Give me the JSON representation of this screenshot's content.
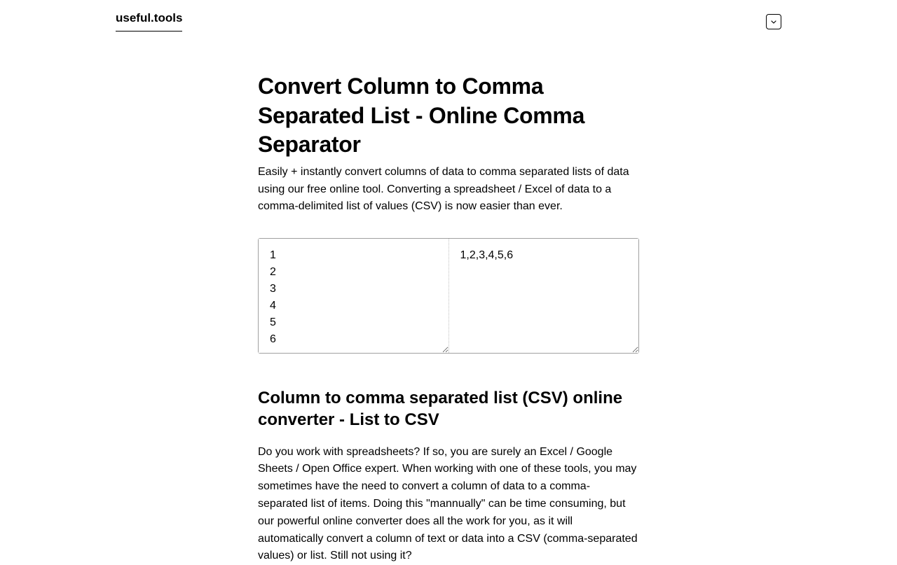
{
  "header": {
    "logo": "useful.tools"
  },
  "main": {
    "title": "Convert Column to Comma Separated List - Online Comma Separator",
    "intro": "Easily + instantly convert columns of data to comma separated lists of data using our free online tool. Converting a spreadsheet / Excel of data to a comma-delimited list of values (CSV) is now easier than ever.",
    "input_value": "1\n2\n3\n4\n5\n6",
    "output_value": "1,2,3,4,5,6",
    "subtitle": "Column to comma separated list (CSV) online converter - List to CSV",
    "body": "Do you work with spreadsheets? If so, you are surely an Excel / Google Sheets / Open Office expert. When working with one of these tools, you may sometimes have the need to convert a column of data to a comma-separated list of items. Doing this \"mannually\" can be time consuming, but our powerful online converter does all the work for you, as it will automatically convert a column of text or data into a CSV (comma-separated values) or list. Still not using it?"
  }
}
